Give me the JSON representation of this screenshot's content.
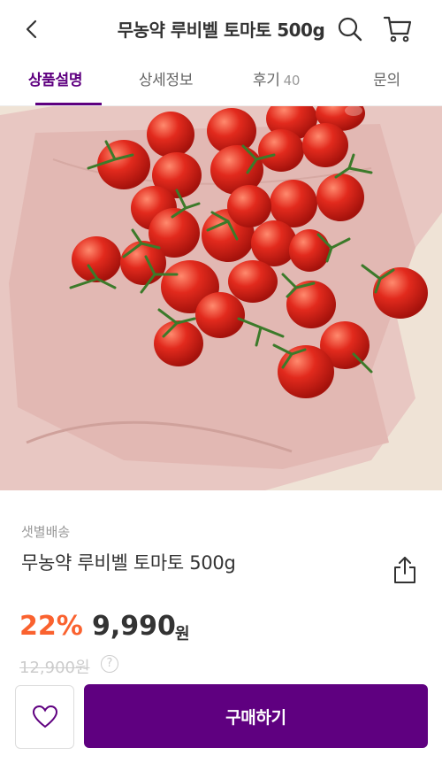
{
  "header": {
    "title": "무농약 루비벨 토마토 500g",
    "back_icon": "chevron-left-icon",
    "search_icon": "search-icon",
    "cart_icon": "cart-icon"
  },
  "tabs": [
    {
      "label": "상품설명",
      "active": true
    },
    {
      "label": "상세정보"
    },
    {
      "label": "후기",
      "count": "40"
    },
    {
      "label": "문의"
    }
  ],
  "product": {
    "image_alt": "tomato-photo",
    "delivery": "샛별배송",
    "name": "무농약 루비벨 토마토 500g",
    "discount": "22%",
    "price": "9,990",
    "currency": "원",
    "original_price": "12,900원",
    "help_glyph": "?"
  },
  "bottom_bar": {
    "like_icon": "heart-icon",
    "buy_label": "구매하기"
  },
  "colors": {
    "brand": "#5f0080",
    "discount": "#fa622f",
    "text": "#333333"
  }
}
